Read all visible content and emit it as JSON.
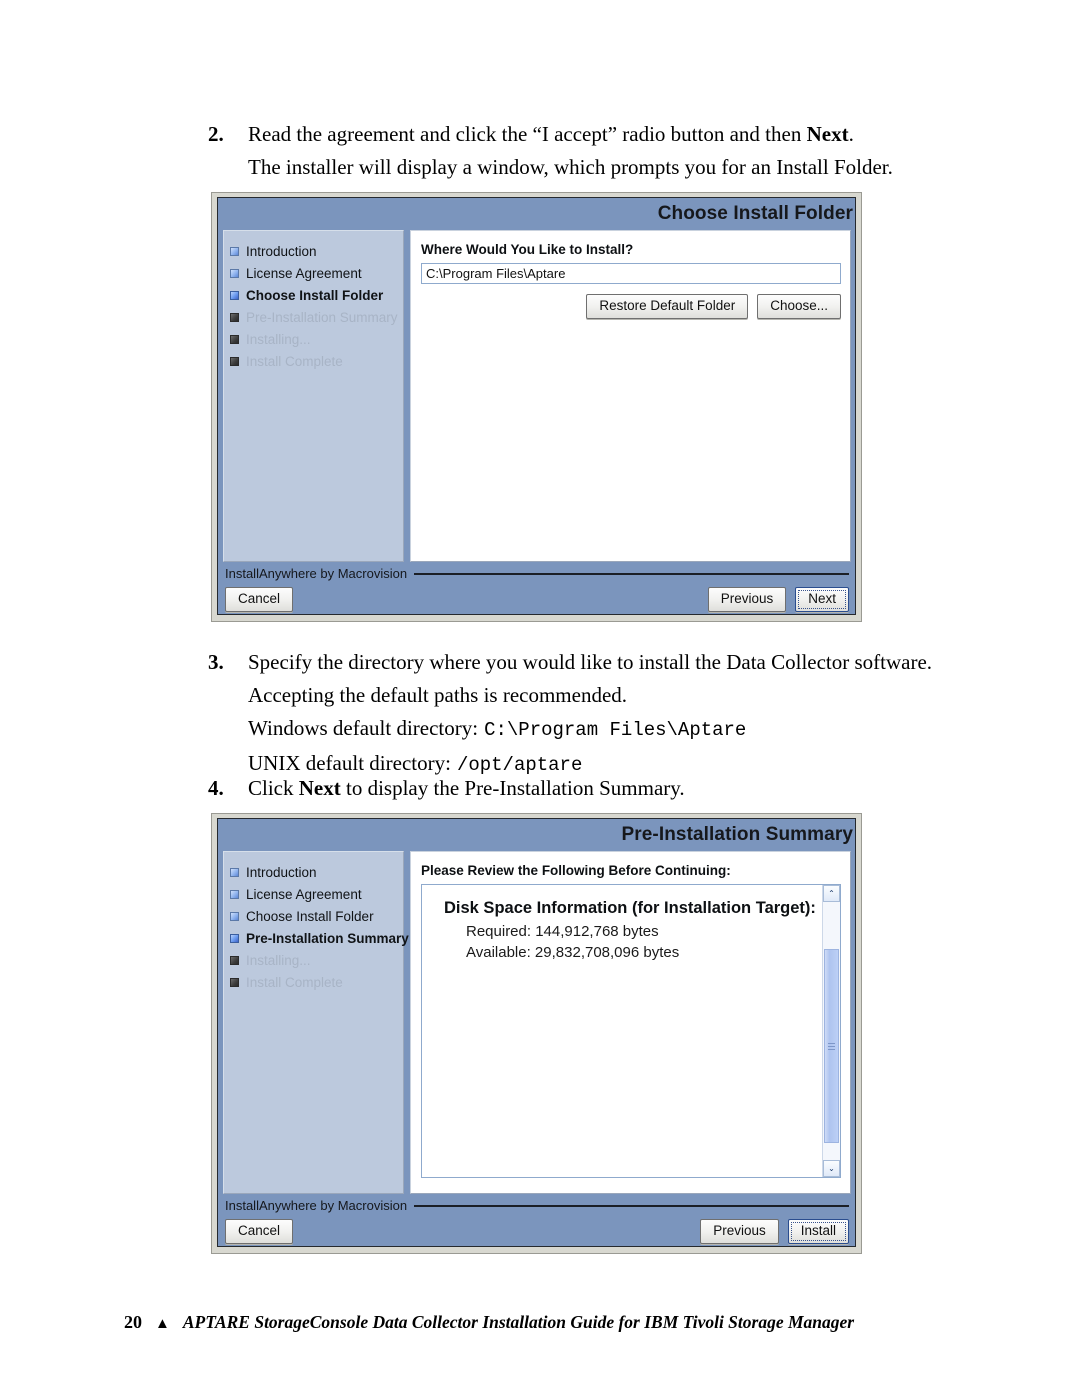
{
  "document": {
    "steps": [
      {
        "number": "2.",
        "lines": [
          "Read the agreement and click the “I accept” radio button and then Next.",
          "The installer will display a window, which prompts you for an Install Folder."
        ]
      },
      {
        "number": "3.",
        "lines": [
          "Specify the directory where you would like to install the Data Collector software.",
          "Accepting the default paths is recommended.",
          "Windows default directory: C:\\Program Files\\Aptare",
          "UNIX default directory: /opt/aptare"
        ],
        "windows_label": "Windows default directory:",
        "windows_path": "C:\\Program Files\\Aptare",
        "unix_label": "UNIX default directory:",
        "unix_path": "/opt/aptare"
      },
      {
        "number": "4.",
        "lines": [
          "Click Next to display the Pre-Installation Summary."
        ]
      }
    ],
    "step2_line1_a": "Read the agreement and click the “I accept” radio button and then ",
    "step2_line1_b": "Next",
    "step2_line1_c": ".",
    "step2_line2": "The installer will display a window, which prompts you for an Install Folder.",
    "step3_line1": "Specify the directory where you would like to install the Data Collector software.",
    "step3_line2": "Accepting the default paths is recommended.",
    "step4_a": "Click ",
    "step4_b": "Next",
    "step4_c": " to display the Pre-Installation Summary."
  },
  "dialog1": {
    "title": "Choose Install Folder",
    "sidebar": {
      "items": [
        {
          "label": "Introduction",
          "state": "done"
        },
        {
          "label": "License Agreement",
          "state": "done"
        },
        {
          "label": "Choose Install Folder",
          "state": "current"
        },
        {
          "label": "Pre-Installation Summary",
          "state": "pending"
        },
        {
          "label": "Installing...",
          "state": "pending"
        },
        {
          "label": "Install Complete",
          "state": "pending"
        }
      ]
    },
    "heading": "Where Would You Like to Install?",
    "path_field": {
      "value": "C:\\Program Files\\Aptare",
      "placeholder": "C:\\Program Files\\Aptare"
    },
    "restore_button": "Restore Default Folder",
    "choose_button": "Choose...",
    "brand": "InstallAnywhere by Macrovision",
    "cancel_button": "Cancel",
    "previous_button": "Previous",
    "next_button": "Next"
  },
  "dialog2": {
    "title": "Pre-Installation Summary",
    "sidebar": {
      "items": [
        {
          "label": "Introduction",
          "state": "done"
        },
        {
          "label": "License Agreement",
          "state": "done"
        },
        {
          "label": "Choose Install Folder",
          "state": "done"
        },
        {
          "label": "Pre-Installation Summary",
          "state": "current"
        },
        {
          "label": "Installing...",
          "state": "pending"
        },
        {
          "label": "Install Complete",
          "state": "pending"
        }
      ]
    },
    "heading": "Please Review the Following Before Continuing:",
    "summary": {
      "title": "Disk Space Information (for Installation Target):",
      "required": "Required: 144,912,768 bytes",
      "available": "Available: 29,832,708,096 bytes"
    },
    "scroll_up_icon": "⌃",
    "scroll_down_icon": "⌄",
    "brand": "InstallAnywhere by Macrovision",
    "cancel_button": "Cancel",
    "previous_button": "Previous",
    "install_button": "Install"
  },
  "footer": {
    "page_number": "20",
    "marker": "▲",
    "text": "APTARE StorageConsole Data Collector Installation Guide for IBM Tivoli Storage Manager"
  },
  "colors": {
    "dialog_blue": "#7b95bd",
    "sidebar_blue": "#bcc9dd",
    "frame_gray": "#d8d8d0",
    "field_border": "#8faacd"
  }
}
